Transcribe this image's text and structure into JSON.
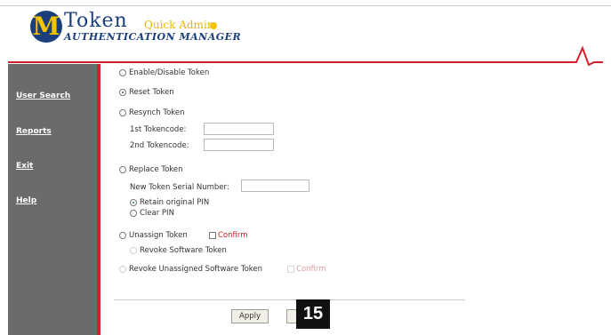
{
  "header": {
    "logo_letter": "M",
    "logo_token": "Token",
    "logo_quick_admin": "Quick Admin",
    "logo_subtitle": "AUTHENTICATION MANAGER"
  },
  "colors": {
    "brand_blue": "#1b3f7c",
    "brand_maize": "#f5c400",
    "accent_red": "#d0202a",
    "sidebar_gray": "#6b6b6b"
  },
  "sidebar": {
    "items": [
      {
        "label": "User Search"
      },
      {
        "label": "Reports"
      },
      {
        "label": "Exit"
      },
      {
        "label": "Help"
      }
    ]
  },
  "form": {
    "enable_disable": "Enable/Disable Token",
    "reset": "Reset Token",
    "resynch": "Resynch Token",
    "first_tokencode": "1st Tokencode:",
    "second_tokencode": "2nd Tokencode:",
    "replace": "Replace Token",
    "new_serial": "New Token Serial Number:",
    "retain_pin": "Retain original PIN",
    "clear_pin": "Clear PIN",
    "unassign": "Unassign Token",
    "confirm": "Confirm",
    "revoke_software": "Revoke Software Token",
    "revoke_unassigned": "Revoke Unassigned Software Token",
    "confirm2": "Confirm",
    "selected_action": "Reset Token",
    "selected_pin_option": "Retain original PIN"
  },
  "buttons": {
    "apply": "Apply"
  },
  "badge": {
    "step": "15"
  }
}
